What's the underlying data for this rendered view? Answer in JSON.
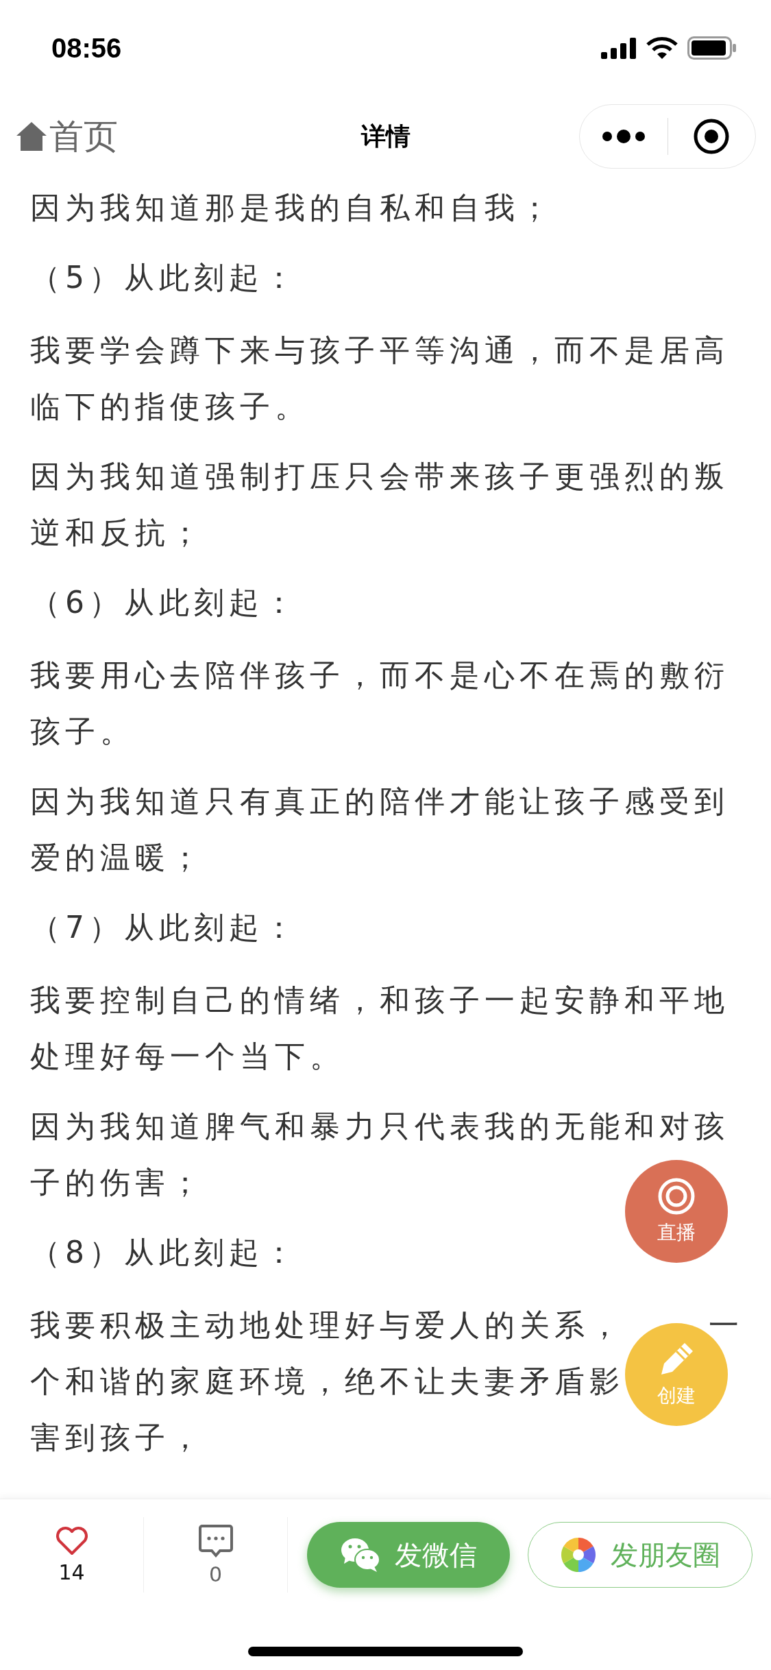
{
  "status_bar": {
    "time": "08:56"
  },
  "nav": {
    "back_label": "首页",
    "title": "详情"
  },
  "paragraphs": [
    {
      "kind": "body",
      "lines": [
        {
          "text": "因为我知道那是我的自私和自我；"
        }
      ]
    },
    {
      "kind": "heading",
      "lines": [
        {
          "text": "（5）从此刻起："
        }
      ]
    },
    {
      "kind": "body",
      "lines": [
        {
          "text": "我要学会蹲下来与孩子平等沟通，而不是居高"
        },
        {
          "text": "临下的指使孩子。"
        }
      ]
    },
    {
      "kind": "body",
      "lines": [
        {
          "text": "因为我知道强制打压只会带来孩子更强烈的叛"
        },
        {
          "text": "逆和反抗；"
        }
      ]
    },
    {
      "kind": "heading",
      "lines": [
        {
          "text": "（6）从此刻起："
        }
      ]
    },
    {
      "kind": "body",
      "lines": [
        {
          "text": "我要用心去陪伴孩子，而不是心不在焉的敷衍"
        },
        {
          "text": "孩子。"
        }
      ]
    },
    {
      "kind": "body",
      "lines": [
        {
          "text": "因为我知道只有真正的陪伴才能让孩子感受到"
        },
        {
          "text": "爱的温暖；"
        }
      ]
    },
    {
      "kind": "heading",
      "lines": [
        {
          "text": "（7）从此刻起："
        }
      ]
    },
    {
      "kind": "body",
      "lines": [
        {
          "text": "我要控制自己的情绪，和孩子一起安静和平地"
        },
        {
          "text": "处理好每一个当下。"
        }
      ]
    },
    {
      "kind": "body",
      "lines": [
        {
          "text": "因为我知道脾气和暴力只代表我的无能和对孩"
        },
        {
          "text": "子的伤害；"
        }
      ]
    },
    {
      "kind": "heading",
      "lines": [
        {
          "text": "（8）从此刻起："
        }
      ]
    },
    {
      "kind": "body",
      "lines": [
        {
          "text": "我要积极主动地处理好与爱人的关系，",
          "after_cover": "一"
        },
        {
          "text": "个和谐的家庭环境，绝不让夫妻矛盾影"
        },
        {
          "text": "害到孩子，"
        }
      ]
    }
  ],
  "float_buttons": [
    {
      "kind": "live",
      "label": "直播",
      "color": "#d97056"
    },
    {
      "kind": "create",
      "label": "创建",
      "color": "#f4c343"
    }
  ],
  "footer": {
    "likes": "14",
    "comments": "0",
    "buttons": [
      {
        "kind": "wechat",
        "label": "发微信"
      },
      {
        "kind": "moments",
        "label": "发朋友圈"
      }
    ]
  }
}
